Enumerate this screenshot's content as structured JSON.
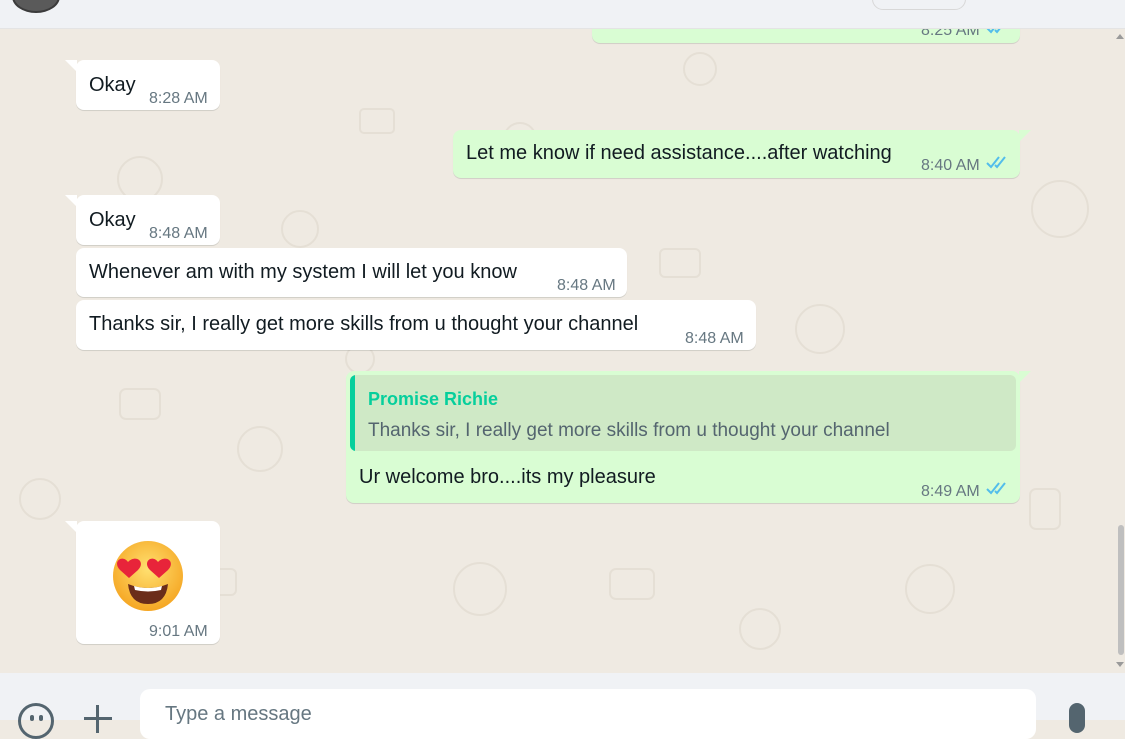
{
  "header": {
    "avatar_icon": "contact-avatar",
    "menu_icon": "header-pill-button"
  },
  "messages": [
    {
      "type": "out",
      "text": "",
      "time": "8:25 AM",
      "status": "read"
    },
    {
      "type": "in",
      "text": "Okay",
      "time": "8:28 AM"
    },
    {
      "type": "out",
      "text": "Let me know if need assistance....after watching",
      "time": "8:40 AM",
      "status": "read"
    },
    {
      "type": "in",
      "text": "Okay",
      "time": "8:48 AM"
    },
    {
      "type": "in",
      "text": "Whenever am with my system I will let you know",
      "time": "8:48 AM"
    },
    {
      "type": "in",
      "text": "Thanks sir, I really get more skills from u thought your channel",
      "time": "8:48 AM"
    },
    {
      "type": "out",
      "quote": {
        "author": "Promise Richie",
        "text": "Thanks sir, I really get more skills from u thought your channel"
      },
      "text": "Ur welcome bro....its my pleasure",
      "time": "8:49 AM",
      "status": "read"
    },
    {
      "type": "in",
      "emoji": "smiling-face-with-heart-eyes",
      "time": "9:01 AM"
    }
  ],
  "composer": {
    "placeholder": "Type a message",
    "emoji_icon": "smiley-icon",
    "attach_icon": "plus-icon",
    "mic_icon": "microphone-icon"
  },
  "colors": {
    "chat_bg": "#efeae2",
    "incoming": "#ffffff",
    "outgoing": "#d9fdd3",
    "read_ticks": "#53bdeb",
    "quote_accent": "#06cf9c"
  }
}
